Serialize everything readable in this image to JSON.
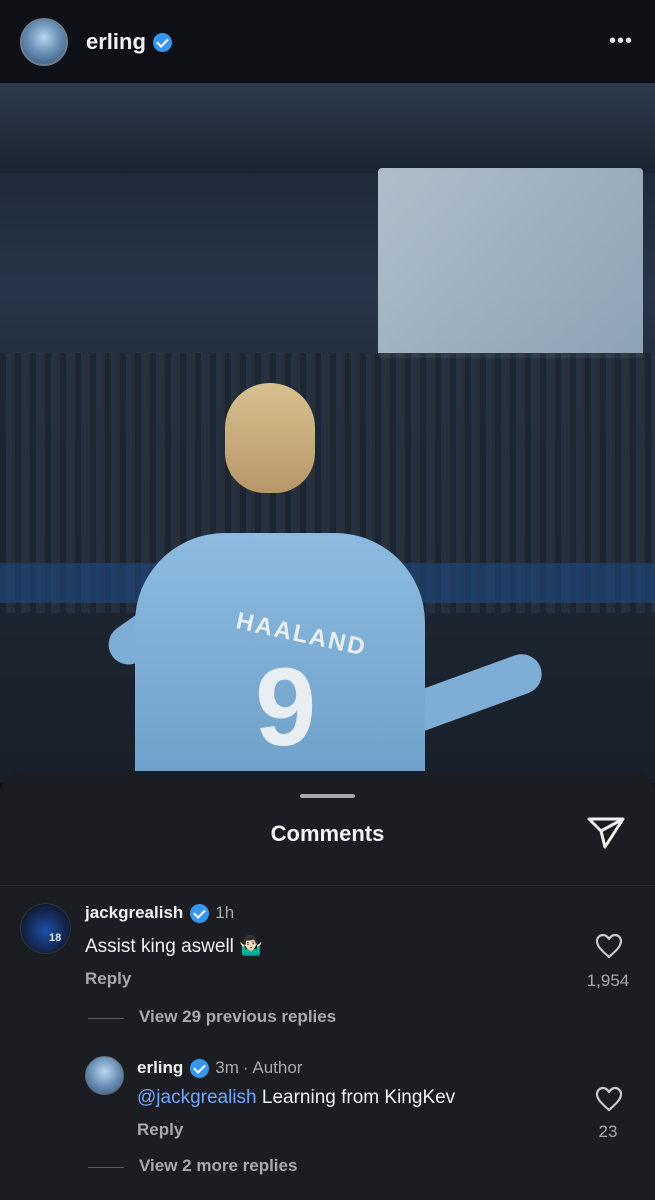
{
  "header": {
    "username": "erling",
    "more_label": "•••"
  },
  "photo": {
    "jersey_name": "HAALAND",
    "jersey_number": "9"
  },
  "comments_sheet": {
    "title": "Comments",
    "comments": [
      {
        "username": "jackgrealish",
        "time": "1h",
        "text": "Assist king aswell 🤷🏻‍♂️",
        "reply_label": "Reply",
        "likes": "1,954",
        "view_replies_label": "View 29 previous replies"
      }
    ],
    "reply": {
      "username": "erling",
      "time": "3m",
      "author_tag": "· Author",
      "mention": "@jackgrealish",
      "text": " Learning from KingKev",
      "reply_label": "Reply",
      "likes": "23",
      "view_more_label": "View 2 more replies"
    }
  },
  "colors": {
    "verified": "#3797f0",
    "mention": "#6fa8ff",
    "sheet_bg": "#1b1d22"
  },
  "icons": [
    "more-options-icon",
    "verified-badge-icon",
    "send-icon",
    "heart-icon"
  ]
}
